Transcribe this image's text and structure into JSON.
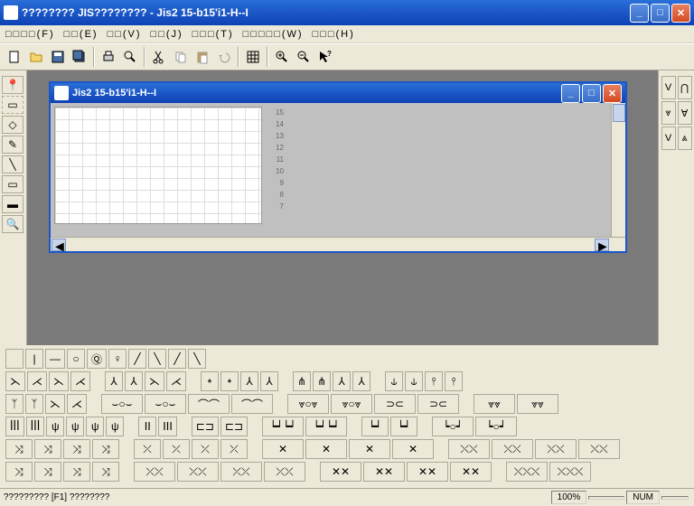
{
  "window": {
    "title": "???????? JIS???????? - Jis2 15-b15'i1-H--I"
  },
  "menu": {
    "file": "□□□□(F)",
    "edit": "□□(E)",
    "view": "□□(V)",
    "j": "□□(J)",
    "t": "□□□(T)",
    "w": "□□□□□(W)",
    "h": "□□□(H)"
  },
  "child": {
    "title": "Jis2 15-b15'i1-H--I",
    "rows": [
      "15",
      "14",
      "13",
      "12",
      "11",
      "10",
      "9",
      "8",
      "7"
    ]
  },
  "status": {
    "left": "????????? [F1] ????????",
    "zoom": "100%",
    "num": "NUM",
    "empty": ""
  }
}
